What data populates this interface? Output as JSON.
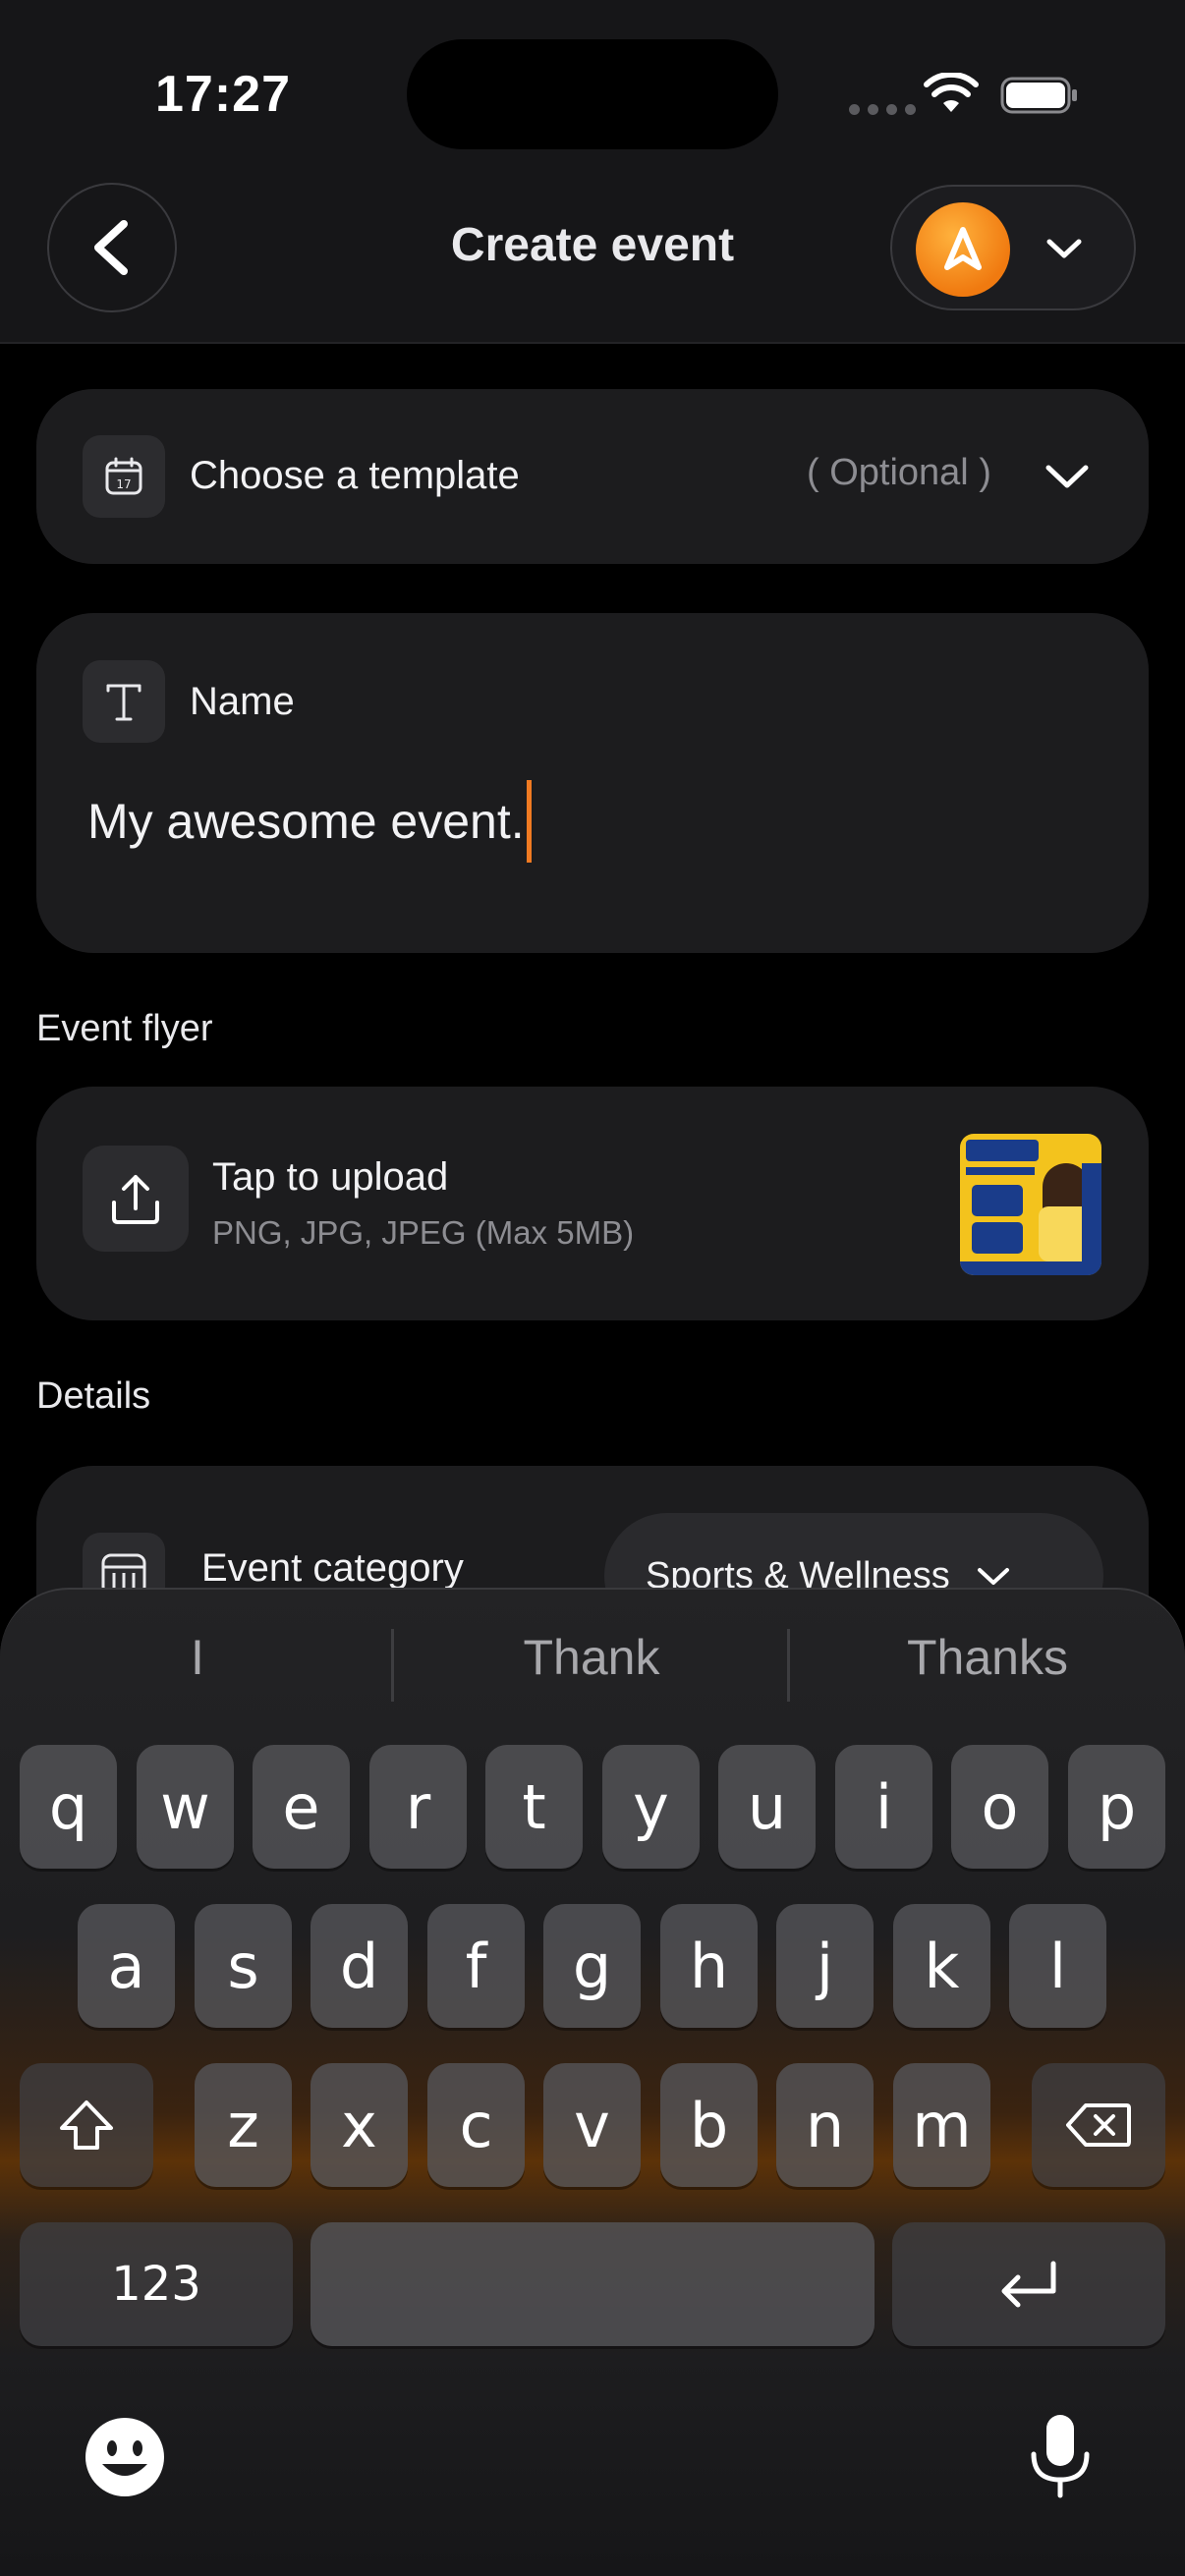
{
  "status_bar": {
    "time": "17:27"
  },
  "header": {
    "title": "Create event"
  },
  "template": {
    "label": "Choose a template",
    "optional": "( Optional )"
  },
  "name_card": {
    "label": "Name",
    "value": "My awesome event."
  },
  "flyer": {
    "section": "Event flyer",
    "title": "Tap to upload",
    "subtitle": "PNG, JPG, JPEG (Max 5MB)"
  },
  "details": {
    "section": "Details",
    "category_label": "Event category",
    "category_value": "Sports & Wellness"
  },
  "keyboard": {
    "suggestions": [
      "I",
      "Thank",
      "Thanks"
    ],
    "row1": [
      "q",
      "w",
      "e",
      "r",
      "t",
      "y",
      "u",
      "i",
      "o",
      "p"
    ],
    "row2": [
      "a",
      "s",
      "d",
      "f",
      "g",
      "h",
      "j",
      "k",
      "l"
    ],
    "row3": [
      "z",
      "x",
      "c",
      "v",
      "b",
      "n",
      "m"
    ],
    "numbers_label": "123"
  },
  "colors": {
    "accent": "#f07a22",
    "background": "#000000",
    "card": "#1c1c1e"
  },
  "icons": [
    "back-chevron-icon",
    "brand-logo-icon",
    "chevron-down-icon",
    "calendar-icon",
    "text-icon",
    "upload-icon",
    "category-icon",
    "shift-icon",
    "backspace-icon",
    "return-icon",
    "emoji-icon",
    "microphone-icon"
  ]
}
